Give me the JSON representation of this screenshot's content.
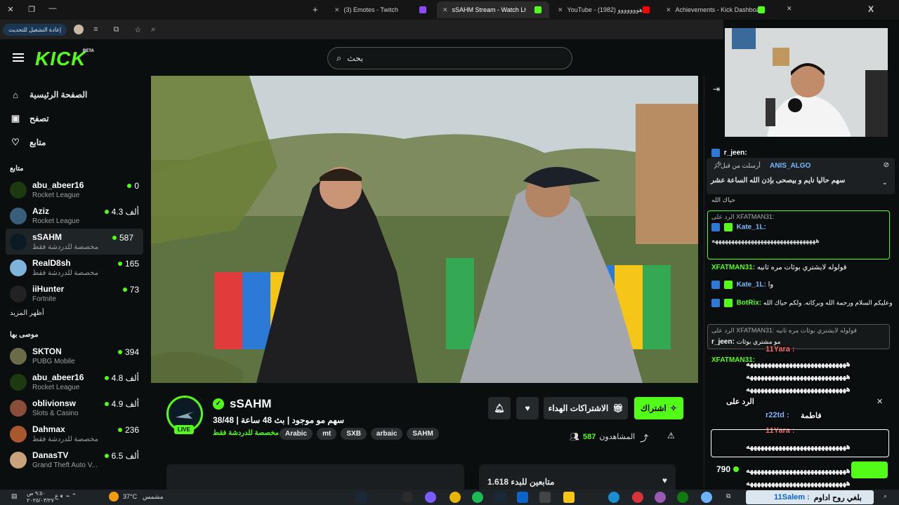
{
  "browser": {
    "tabs": [
      {
        "label": "(3) Emotes - Twitch",
        "active": false
      },
      {
        "label": "sSAHM Stream - Watch Live",
        "active": true
      },
      {
        "label": "YouTube - (1982) ياهووووووو",
        "active": false
      },
      {
        "label": "Achievements - Kick Dashboard",
        "active": false
      }
    ],
    "update_button": "إعادة التشغيل للتحديث"
  },
  "header": {
    "logo": "KICK",
    "beta": "BETA",
    "search_placeholder": "بحث"
  },
  "sidebar": {
    "nav": [
      {
        "label": "الصفحة الرئيسية",
        "icon": "home-icon"
      },
      {
        "label": "تصفح",
        "icon": "browse-icon"
      },
      {
        "label": "متابع",
        "icon": "heart-icon"
      }
    ],
    "following_title": "متابع",
    "following": [
      {
        "name": "abu_abeer16",
        "category": "Rocket League",
        "viewers": "0",
        "color": "#1b3a10"
      },
      {
        "name": "Aziz",
        "category": "Rocket League",
        "viewers": "4.3 ألف",
        "color": "#3a5d7a"
      },
      {
        "name": "sSAHM",
        "category": "مخصصة للدردشة فقط",
        "viewers": "587",
        "color": "#0c1a24"
      },
      {
        "name": "RealD8sh",
        "category": "مخصصة للدردشة فقط",
        "viewers": "165",
        "color": "#7fb3d9"
      },
      {
        "name": "iiHunter",
        "category": "Fortnite",
        "viewers": "73",
        "color": "#222"
      }
    ],
    "show_more": "أظهر المزيد",
    "recommended_title": "موصى بها",
    "recommended": [
      {
        "name": "SKTON",
        "category": "PUBG Mobile",
        "viewers": "394",
        "color": "#6b6b4a"
      },
      {
        "name": "abu_abeer16",
        "category": "Rocket League",
        "viewers": "4.8 ألف",
        "color": "#1b3a10"
      },
      {
        "name": "oblivionsw",
        "category": "Slots & Casino",
        "viewers": "4.9 ألف",
        "color": "#8a4d3a"
      },
      {
        "name": "Dahmax",
        "category": "مخصصة للدردشة فقط",
        "viewers": "236",
        "color": "#a8572e"
      },
      {
        "name": "DanasTV",
        "category": "Grand Theft Auto V...",
        "viewers": "6.5 ألف",
        "color": "#c9a27a"
      }
    ]
  },
  "stream": {
    "channel_name": "sSAHM",
    "live_badge": "LIVE",
    "title": "سهم مو موجود | بث 48 ساعة | 38/48",
    "category": "مخصصة للدردشة فقط",
    "tags": [
      "Arabic",
      "mt",
      "SXB",
      "arbaic",
      "SAHM"
    ],
    "subscribe_label": "اشتراك",
    "gift_label": "الاشتراكات الهداء",
    "viewers_count": "587",
    "viewers_label": "المشاهدون",
    "followers_text": "متابعين للبدء 1.618"
  },
  "chat": {
    "pinned_sender": "ANIS_ALGO",
    "pinned_meta": "أرسلت من قبل",
    "pinned_message": "سهم حاليا نايم و بيصحى بإذن الله الساعة عشر",
    "lines": [
      {
        "name": "r_jeen:",
        "text": "",
        "color": "#ffffff"
      },
      {
        "name": "",
        "text": "حياك الله",
        "color": "#ffffff"
      },
      {
        "name": "",
        "text": "الرد على XFATMAN31:",
        "color": "#aaaaaa"
      },
      {
        "name": "Kate_1L:",
        "text": "ههههههههههههههههههههههههههههههههه",
        "color": "#79b8ff"
      },
      {
        "name": "XFATMAN31:",
        "text": "قولوله لايشتري بوئات مره ثانيه",
        "color": "#53fc18"
      },
      {
        "name": "Kate_1L:",
        "text": "وا",
        "color": "#79b8ff"
      },
      {
        "name": "BotRix:",
        "text": "وعليكم السلام ورحمة الله وبركاته. ولكم حياك الله",
        "color": "#53fc18"
      },
      {
        "name": "",
        "text": "الرد على XFATMAN31: قولوله لايشتري بوئات مره ثانيه",
        "color": "#aaaaaa"
      },
      {
        "name": "r_jeen:",
        "text": "مو مشتري بوئات",
        "color": "#ffffff"
      },
      {
        "name": "XFATMAN31:",
        "text": "",
        "color": "#53fc18"
      }
    ],
    "overlay": {
      "name1": "11Yara :",
      "name2": "r22td :",
      "name3": "11Yara :",
      "name4": "11Salem :",
      "reply_to": "الرد على",
      "fatima": "فاطمة",
      "message": "ههههههههههههههههههههههههههههه",
      "bottom_message": "بلغي روح اداوم",
      "count": "790"
    }
  },
  "taskbar": {
    "weather": "37°C",
    "weather_label": "مشمس",
    "time": "٩:٥٠ ص",
    "date": "٢٠٢٥/٠٣/٢٧"
  }
}
